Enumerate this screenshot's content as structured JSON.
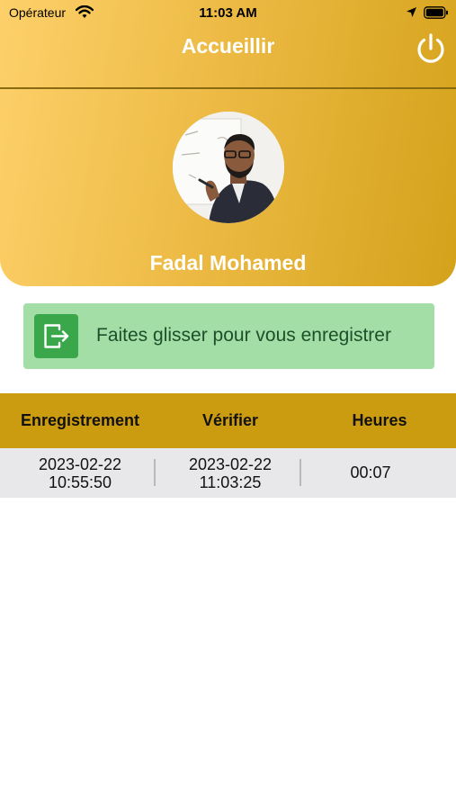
{
  "status_bar": {
    "carrier": "Opérateur",
    "time": "11:03 AM"
  },
  "header": {
    "title": "Accueillir",
    "user_name": "Fadal Mohamed",
    "background_colors": [
      "#fdd06a",
      "#d4a21a"
    ]
  },
  "icons": {
    "power": "power-icon",
    "exit": "exit-door-icon",
    "wifi": "wifi-icon",
    "location": "location-arrow-icon",
    "battery": "battery-icon"
  },
  "swipe": {
    "label": "Faites glisser pour vous enregistrer",
    "background": "#a3dea6",
    "handle_color": "#3aa84a"
  },
  "table": {
    "header_color": "#cc9c10",
    "columns": [
      "Enregistrement",
      "Vérifier",
      "Heures"
    ],
    "rows": [
      {
        "checkin_date": "2023-02-22",
        "checkin_time": "10:55:50",
        "checkout_date": "2023-02-22",
        "checkout_time": "11:03:25",
        "hours": "00:07"
      }
    ]
  }
}
